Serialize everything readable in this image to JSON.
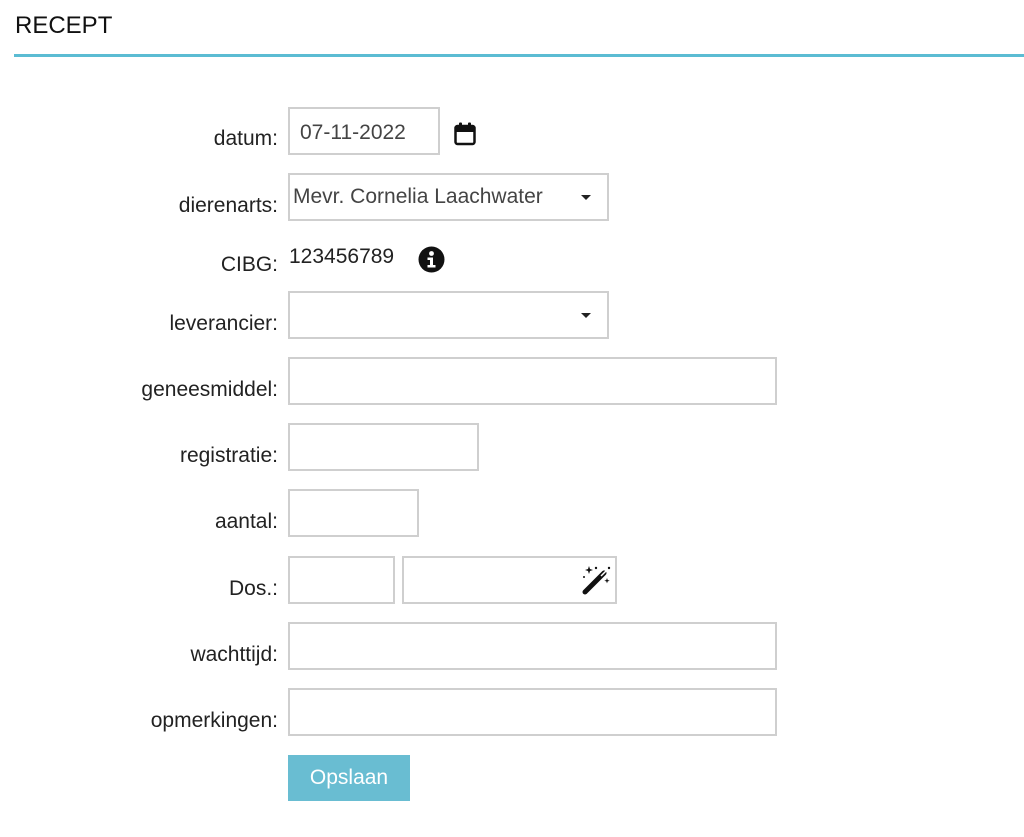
{
  "header": {
    "title": "RECEPT"
  },
  "form": {
    "datum": {
      "label": "datum:",
      "value": "07-11-2022"
    },
    "dierenarts": {
      "label": "dierenarts:",
      "value": "Mevr. Cornelia Laachwater"
    },
    "cibg": {
      "label": "CIBG:",
      "value": "123456789"
    },
    "leverancier": {
      "label": "leverancier:",
      "value": ""
    },
    "geneesmiddel": {
      "label": "geneesmiddel:",
      "value": ""
    },
    "registratie": {
      "label": "registratie:",
      "value": ""
    },
    "aantal": {
      "label": "aantal:",
      "value": ""
    },
    "dos": {
      "label": "Dos.:",
      "value_a": "",
      "value_b": ""
    },
    "wachttijd": {
      "label": "wachttijd:",
      "value": ""
    },
    "opmerkingen": {
      "label": "opmerkingen:",
      "value": ""
    }
  },
  "actions": {
    "save_label": "Opslaan"
  },
  "icons": {
    "calendar": "calendar-icon",
    "info": "info-icon",
    "magic": "magic-wand-icon",
    "dropdown": "chevron-down-icon"
  },
  "colors": {
    "accent": "#5bbcd3",
    "button": "#69bdd2"
  }
}
